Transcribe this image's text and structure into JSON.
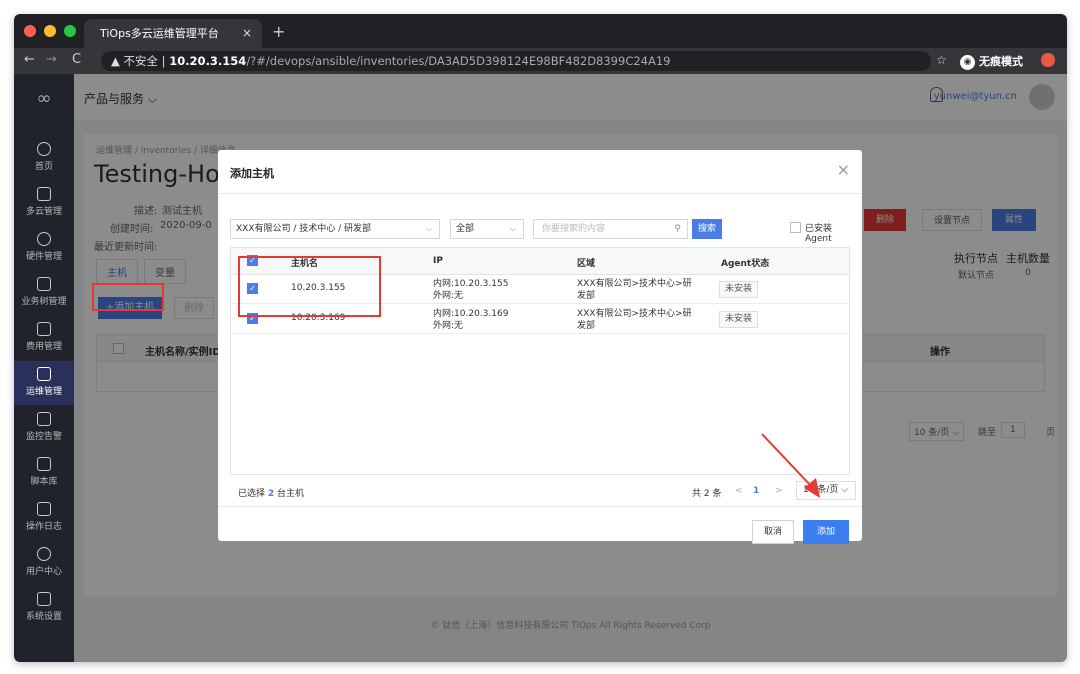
{
  "browser": {
    "tab_title": "TiOps多云运维管理平台",
    "tab_close": "×",
    "new_tab": "+",
    "security_label": "不安全",
    "url_host": "10.20.3.154",
    "url_path": "/?#/devops/ansible/inventories/DA3AD5D398124E98BF482D8399C24A19",
    "incognito_label": "无痕模式",
    "back": "←",
    "forward": "→",
    "reload": "C",
    "star": "☆",
    "incognito_icon": "◉"
  },
  "topnav": {
    "products_label": "产品与服务 ⌵",
    "user_email": "yunwei@tyun.cn"
  },
  "sidebar": {
    "items": [
      {
        "label": "首页",
        "icon": "home-icon"
      },
      {
        "label": "多云管理",
        "icon": "cloud-icon"
      },
      {
        "label": "硬件管理",
        "icon": "hardware-icon"
      },
      {
        "label": "业务树管理",
        "icon": "tree-icon"
      },
      {
        "label": "费用管理",
        "icon": "cost-icon"
      },
      {
        "label": "运维管理",
        "icon": "ops-icon",
        "active": true
      },
      {
        "label": "监控告警",
        "icon": "alert-icon"
      },
      {
        "label": "脚本库",
        "icon": "script-icon"
      },
      {
        "label": "操作日志",
        "icon": "log-icon"
      },
      {
        "label": "用户中心",
        "icon": "user-icon"
      },
      {
        "label": "系统设置",
        "icon": "settings-icon"
      }
    ]
  },
  "page": {
    "breadcrumb": "运维管理  /  Inventories  /  详细信息",
    "title": "Testing-Hos",
    "desc_label": "描述:",
    "desc_value": "测试主机",
    "created_label": "创建时间:",
    "created_value": "2020-09-0",
    "updated_label": "最近更新时间:",
    "tab_hosts": "主机",
    "tab_vars": "变量",
    "add_host_button": "+添加主机",
    "delete_button": "删除",
    "table_col_name": "主机名称/实例ID",
    "table_col_ops": "操作",
    "btn_delete_red": "删除",
    "btn_set_node": "设置节点",
    "btn_attr": "属性",
    "stat_exec_node": "执行节点",
    "stat_host_count": "主机数量",
    "stat_default_node": "默认节点",
    "stat_host_count_value": "0",
    "pager_size": "10 条/页 ⌵",
    "pager_jump": "跳至",
    "pager_jump_value": "1",
    "pager_page": "页",
    "footer": "© 钛信（上海）信息科技有限公司 TiOps All Rights Reserved Corp"
  },
  "modal": {
    "title": "添加主机",
    "close": "×",
    "org_select": "XXX有限公司 / 技术中心 / 研发部",
    "scope_select": "全部",
    "search_placeholder": "你要搜索的内容",
    "search_button": "搜索",
    "installed_agent_label": "已安装Agent",
    "columns": {
      "hostname": "主机名",
      "ip": "IP",
      "region": "区域",
      "agent": "Agent状态"
    },
    "rows": [
      {
        "hostname": "10.20.3.155",
        "ip_internal": "内网:10.20.3.155",
        "ip_external": "外网:无",
        "region_line1": "XXX有限公司>技术中心>研",
        "region_line2": "发部",
        "agent": "未安装",
        "checked": true
      },
      {
        "hostname": "10.20.3.169",
        "ip_internal": "内网:10.20.3.169",
        "ip_external": "外网:无",
        "region_line1": "XXX有限公司>技术中心>研",
        "region_line2": "发部",
        "agent": "未安装",
        "checked": true
      }
    ],
    "selected_prefix": "已选择",
    "selected_count": "2",
    "selected_suffix": "台主机",
    "total": "共 2 条",
    "prev": "<",
    "page": "1",
    "next": ">",
    "page_size": "10 条/页 ⌵",
    "cancel_button": "取消",
    "add_button": "添加"
  },
  "colors": {
    "primary": "#4c7de6",
    "annotation_red": "#e53935",
    "sidebar_bg": "#20232b"
  }
}
